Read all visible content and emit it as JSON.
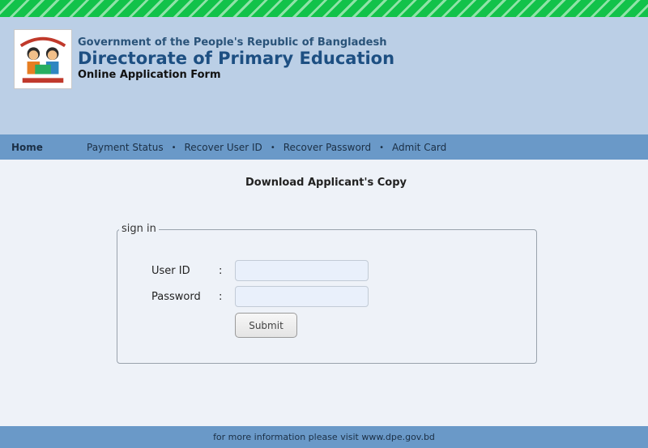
{
  "header": {
    "gov_line": "Government of the People's Republic of Bangladesh",
    "dept_title": "Directorate of Primary Education",
    "form_subtitle": "Online Application Form",
    "logo_icon": "primary-education-logo"
  },
  "nav": {
    "home": "Home",
    "links": [
      "Payment Status",
      "Recover User ID",
      "Recover Password",
      "Admit Card"
    ],
    "separator": "•"
  },
  "page_heading": "Download Applicant's Copy",
  "signin": {
    "legend": "sign in",
    "user_id_label": "User ID",
    "password_label": "Password",
    "colon": ":",
    "user_id_value": "",
    "password_value": "",
    "submit_label": "Submit"
  },
  "footer": {
    "text": "for more information please visit ",
    "link": "www.dpe.gov.bd"
  },
  "colors": {
    "stripe_green": "#12c24a",
    "header_bg": "#bbcfe6",
    "nav_bg": "#6a99c8",
    "title_blue": "#1d4f82",
    "page_bg": "#eef2f8"
  }
}
